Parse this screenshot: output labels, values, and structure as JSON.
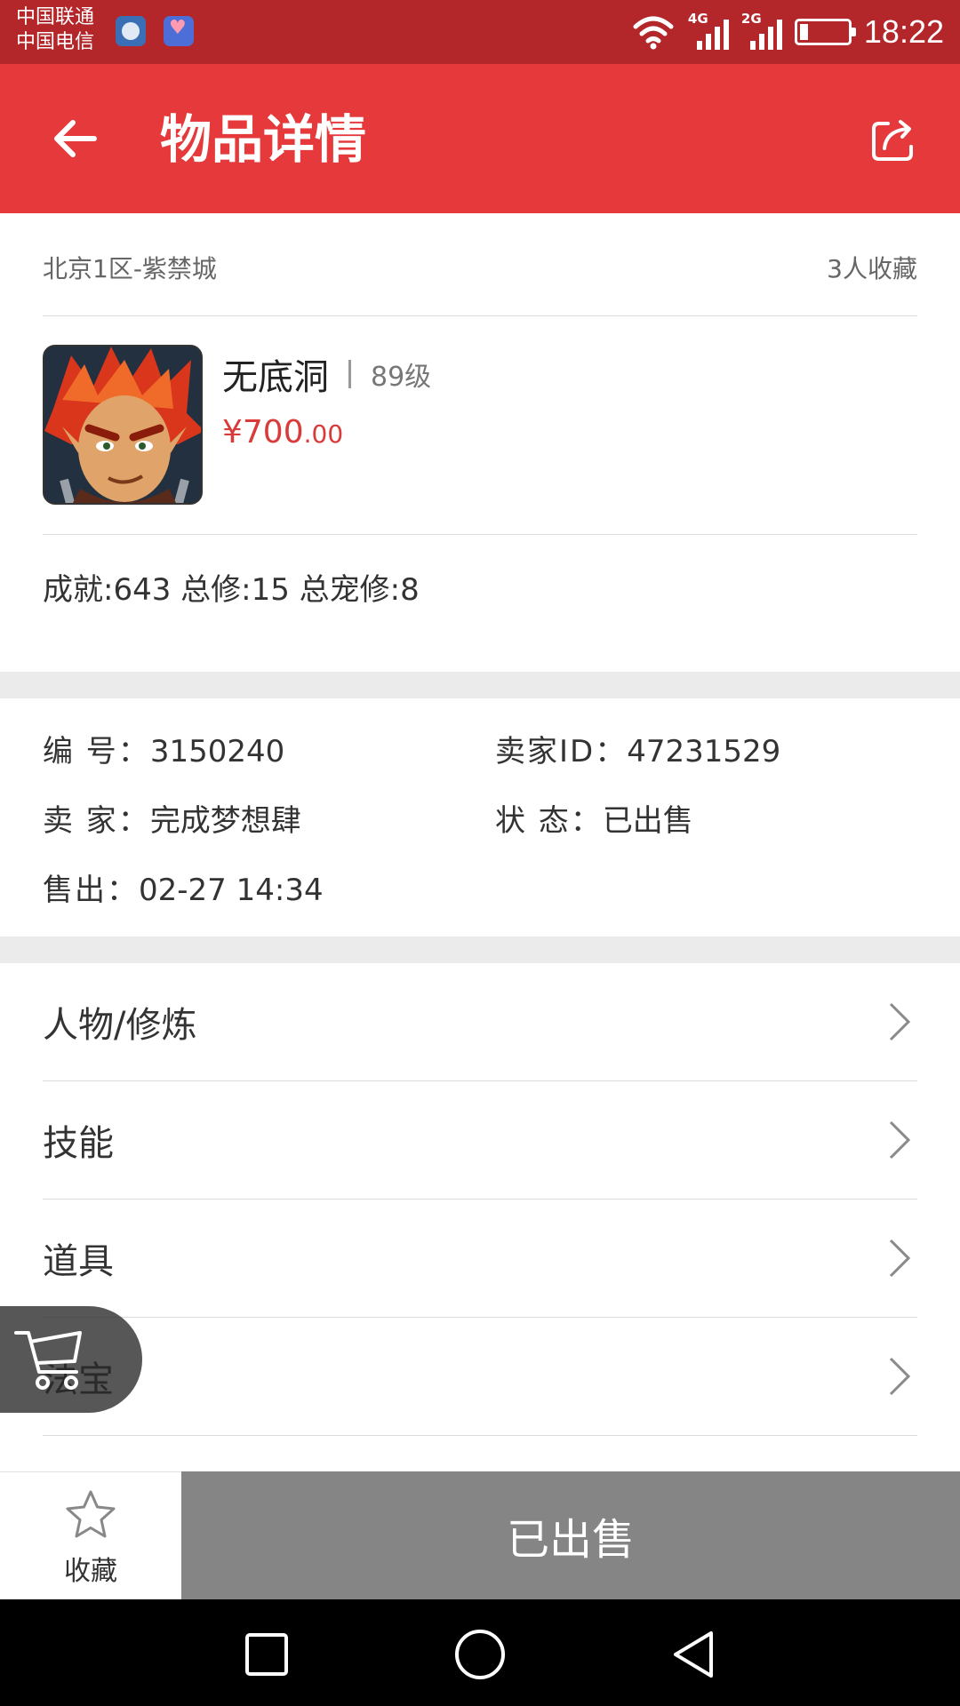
{
  "status_bar": {
    "carrier_1": "中国联通",
    "carrier_2": "中国电信",
    "network_1": "4G",
    "network_2": "2G",
    "time": "18:22",
    "icons": [
      "app-notification-icon",
      "health-app-icon",
      "wifi-icon",
      "signal-icon",
      "battery-icon"
    ]
  },
  "app_bar": {
    "title": "物品详情",
    "back_icon": "arrow-left-icon",
    "share_icon": "share-icon",
    "color": "#e5393b"
  },
  "item": {
    "server": "北京1区-紫禁城",
    "favorites_count": "3人收藏",
    "name": "无底洞",
    "level": "89级",
    "price_main": "¥700",
    "price_decimal": ".00",
    "stats": "成就:643 总修:15 总宠修:8",
    "price_color": "#d93a3a"
  },
  "info": {
    "id_label": "编  号：",
    "id_value": "3150240",
    "seller_id_label": "卖家ID：",
    "seller_id_value": "47231529",
    "seller_label": "卖  家：",
    "seller_value": "完成梦想肆",
    "status_label": "状  态：",
    "status_value": "已出售",
    "sold_label": "售出：",
    "sold_value": "02-27 14:34"
  },
  "menu": {
    "items": [
      {
        "label": "人物/修炼"
      },
      {
        "label": "技能"
      },
      {
        "label": "道具"
      },
      {
        "label": "法宝"
      }
    ],
    "chevron_icon": "chevron-right-icon"
  },
  "floating": {
    "cart_icon": "cart-icon"
  },
  "bottom_bar": {
    "favorite_label": "收藏",
    "favorite_icon": "star-icon",
    "action_label": "已出售",
    "action_color": "#858585"
  },
  "nav_bar": {
    "icons": [
      "recent-apps-icon",
      "home-icon",
      "back-icon"
    ]
  }
}
